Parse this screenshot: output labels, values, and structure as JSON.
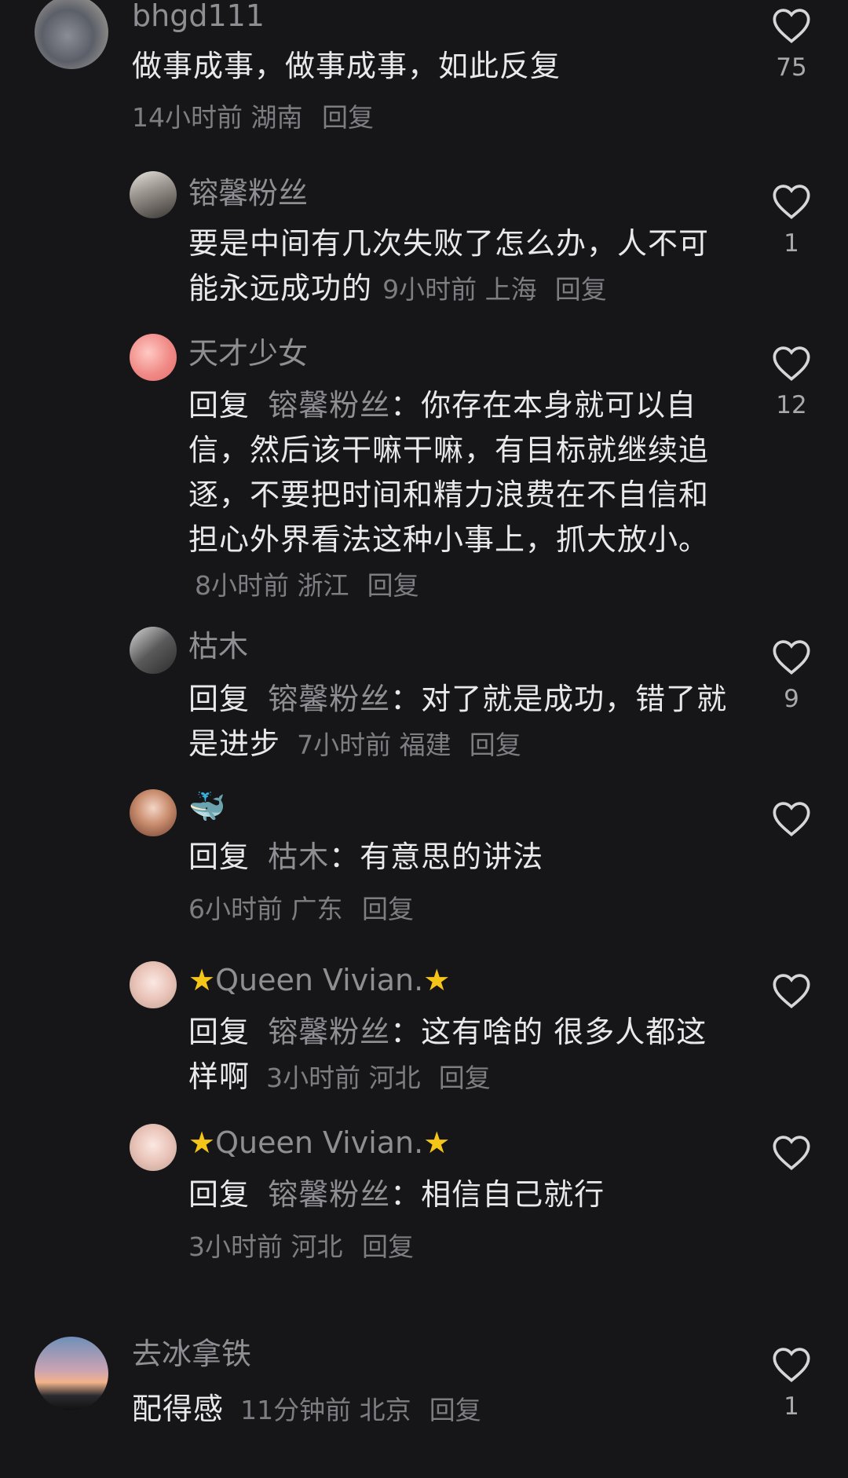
{
  "comments": [
    {
      "id": "c1",
      "user": "bhgd111",
      "text": "做事成事，做事成事，如此反复",
      "meta": "14小时前 湖南",
      "reply": "回复",
      "likes": "75"
    },
    {
      "id": "r1",
      "user": "镕馨粉丝",
      "text": "要是中间有几次失败了怎么办，人不可能永远成功的",
      "meta": "9小时前 上海",
      "reply": "回复",
      "likes": "1"
    },
    {
      "id": "r2",
      "user": "天才少女",
      "reply_prefix": "回复",
      "mention": "镕馨粉丝",
      "text": "：你存在本身就可以自信，然后该干嘛干嘛，有目标就继续追逐，不要把时间和精力浪费在不自信和担心外界看法这种小事上，抓大放小。",
      "meta": "8小时前 浙江",
      "reply": "回复",
      "likes": "12"
    },
    {
      "id": "r3",
      "user": "枯木",
      "reply_prefix": "回复",
      "mention": "镕馨粉丝",
      "text": "：对了就是成功，错了就是进步",
      "meta": "7小时前 福建",
      "reply": "回复",
      "likes": "9"
    },
    {
      "id": "r4",
      "user": "🐳",
      "reply_prefix": "回复",
      "mention": "枯木",
      "text": "：有意思的讲法",
      "meta": "6小时前 广东",
      "reply": "回复",
      "likes": ""
    },
    {
      "id": "r5",
      "user": "Queen Vivian.",
      "reply_prefix": "回复",
      "mention": "镕馨粉丝",
      "text": "：这有啥的 很多人都这样啊",
      "meta": "3小时前 河北",
      "reply": "回复",
      "likes": ""
    },
    {
      "id": "r6",
      "user": "Queen Vivian.",
      "reply_prefix": "回复",
      "mention": "镕馨粉丝",
      "text": "：相信自己就行",
      "meta": "3小时前 河北",
      "reply": "回复",
      "likes": ""
    },
    {
      "id": "c2",
      "user": "去冰拿铁",
      "text": "配得感",
      "meta": "11分钟前 北京",
      "reply": "回复",
      "likes": "1"
    }
  ],
  "colors": {
    "background": "#161619",
    "text": "#e9e9ec",
    "muted": "#8e8e93",
    "star": "#f5c518"
  },
  "icons": {
    "like": "heart-outline-icon",
    "star": "star-icon"
  }
}
